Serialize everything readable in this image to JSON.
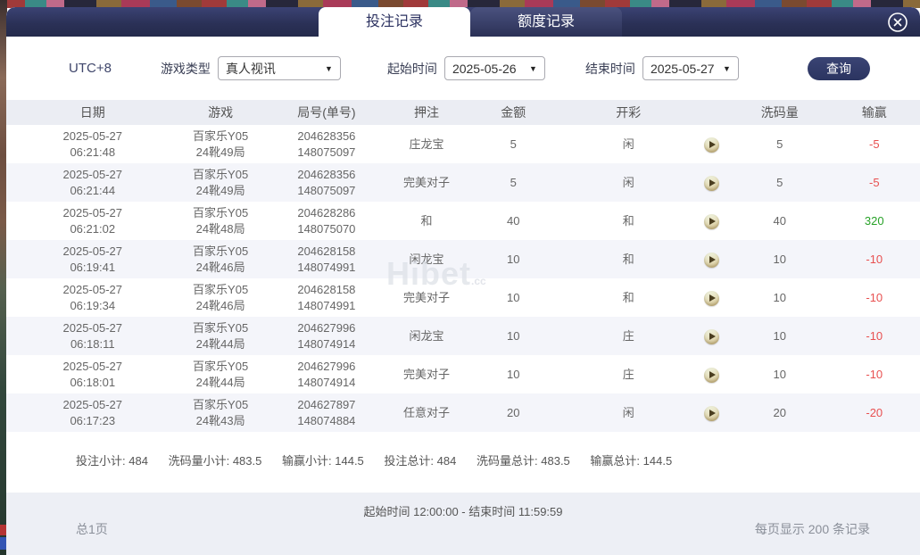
{
  "tabs": [
    {
      "label": "投注记录"
    },
    {
      "label": "额度记录"
    }
  ],
  "filters": {
    "timezone": "UTC+8",
    "game_type_label": "游戏类型",
    "game_type_value": "真人视讯",
    "start_label": "起始时间",
    "start_value": "2025-05-26",
    "end_label": "结束时间",
    "end_value": "2025-05-27",
    "search_label": "查询",
    "dropdown_arrow": "▼"
  },
  "watermark": {
    "text": "Hibet",
    "suffix": ".cc"
  },
  "table": {
    "headers": [
      "日期",
      "游戏",
      "局号(单号)",
      "押注",
      "金额",
      "开彩",
      "洗码量",
      "输赢"
    ],
    "rows": [
      {
        "date": "2025-05-27",
        "time": "06:21:48",
        "game": "百家乐Y05",
        "round": "24靴49局",
        "bet_no": "204628356",
        "order_no": "148075097",
        "bet": "庄龙宝",
        "amount": "5",
        "result": "闲",
        "rolling": "5",
        "winloss": "-5",
        "wl_class": "red"
      },
      {
        "date": "2025-05-27",
        "time": "06:21:44",
        "game": "百家乐Y05",
        "round": "24靴49局",
        "bet_no": "204628356",
        "order_no": "148075097",
        "bet": "完美对子",
        "amount": "5",
        "result": "闲",
        "rolling": "5",
        "winloss": "-5",
        "wl_class": "red"
      },
      {
        "date": "2025-05-27",
        "time": "06:21:02",
        "game": "百家乐Y05",
        "round": "24靴48局",
        "bet_no": "204628286",
        "order_no": "148075070",
        "bet": "和",
        "amount": "40",
        "result": "和",
        "rolling": "40",
        "winloss": "320",
        "wl_class": "green"
      },
      {
        "date": "2025-05-27",
        "time": "06:19:41",
        "game": "百家乐Y05",
        "round": "24靴46局",
        "bet_no": "204628158",
        "order_no": "148074991",
        "bet": "闲龙宝",
        "amount": "10",
        "result": "和",
        "rolling": "10",
        "winloss": "-10",
        "wl_class": "red"
      },
      {
        "date": "2025-05-27",
        "time": "06:19:34",
        "game": "百家乐Y05",
        "round": "24靴46局",
        "bet_no": "204628158",
        "order_no": "148074991",
        "bet": "完美对子",
        "amount": "10",
        "result": "和",
        "rolling": "10",
        "winloss": "-10",
        "wl_class": "red"
      },
      {
        "date": "2025-05-27",
        "time": "06:18:11",
        "game": "百家乐Y05",
        "round": "24靴44局",
        "bet_no": "204627996",
        "order_no": "148074914",
        "bet": "闲龙宝",
        "amount": "10",
        "result": "庄",
        "rolling": "10",
        "winloss": "-10",
        "wl_class": "red"
      },
      {
        "date": "2025-05-27",
        "time": "06:18:01",
        "game": "百家乐Y05",
        "round": "24靴44局",
        "bet_no": "204627996",
        "order_no": "148074914",
        "bet": "完美对子",
        "amount": "10",
        "result": "庄",
        "rolling": "10",
        "winloss": "-10",
        "wl_class": "red"
      },
      {
        "date": "2025-05-27",
        "time": "06:17:23",
        "game": "百家乐Y05",
        "round": "24靴43局",
        "bet_no": "204627897",
        "order_no": "148074884",
        "bet": "任意对子",
        "amount": "20",
        "result": "闲",
        "rolling": "20",
        "winloss": "-20",
        "wl_class": "red"
      }
    ]
  },
  "summary": {
    "items": [
      {
        "label": "投注小计:",
        "value": "484"
      },
      {
        "label": "洗码量小计:",
        "value": "483.5"
      },
      {
        "label": "输赢小计:",
        "value": "144.5"
      },
      {
        "label": "投注总计:",
        "value": "484"
      },
      {
        "label": "洗码量总计:",
        "value": "483.5"
      },
      {
        "label": "输赢总计:",
        "value": "144.5"
      }
    ]
  },
  "footer": {
    "time_range": "起始时间 12:00:00 - 结束时间 11:59:59",
    "page_info": "总1页",
    "per_page": "每页显示 200 条记录"
  },
  "colors": {
    "titlebar_navy": "#2b3157",
    "accent_navy": "#2f3864",
    "loss_red": "#e85050",
    "win_green": "#28a228",
    "footer_bg": "#edeff5"
  }
}
